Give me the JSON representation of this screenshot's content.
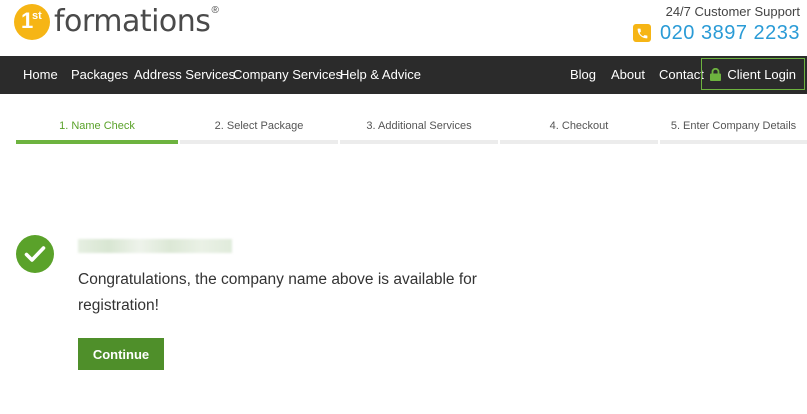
{
  "header": {
    "logo_one": "1",
    "logo_st": "st",
    "logo_text": "formations",
    "logo_reg": "®",
    "support_label": "24/7 Customer Support",
    "phone": "020 3897 2233"
  },
  "nav": {
    "left": [
      "Home",
      "Packages",
      "Address Services",
      "Company Services",
      "Help & Advice"
    ],
    "right": [
      "Blog",
      "About",
      "Contact"
    ],
    "client_login": "Client Login"
  },
  "steps": [
    {
      "label": "1. Name Check",
      "active": true
    },
    {
      "label": "2. Select Package",
      "active": false
    },
    {
      "label": "3. Additional Services",
      "active": false
    },
    {
      "label": "4. Checkout",
      "active": false
    },
    {
      "label": "5. Enter Company Details",
      "active": false
    }
  ],
  "result": {
    "message": "Congratulations, the company name above is available for registration!",
    "continue_label": "Continue"
  },
  "colors": {
    "brand_yellow": "#f6b515",
    "nav_bg": "#2b2b2b",
    "accent_green": "#6db33f",
    "button_green": "#4f8f2a",
    "phone_blue": "#2a9bd6"
  }
}
